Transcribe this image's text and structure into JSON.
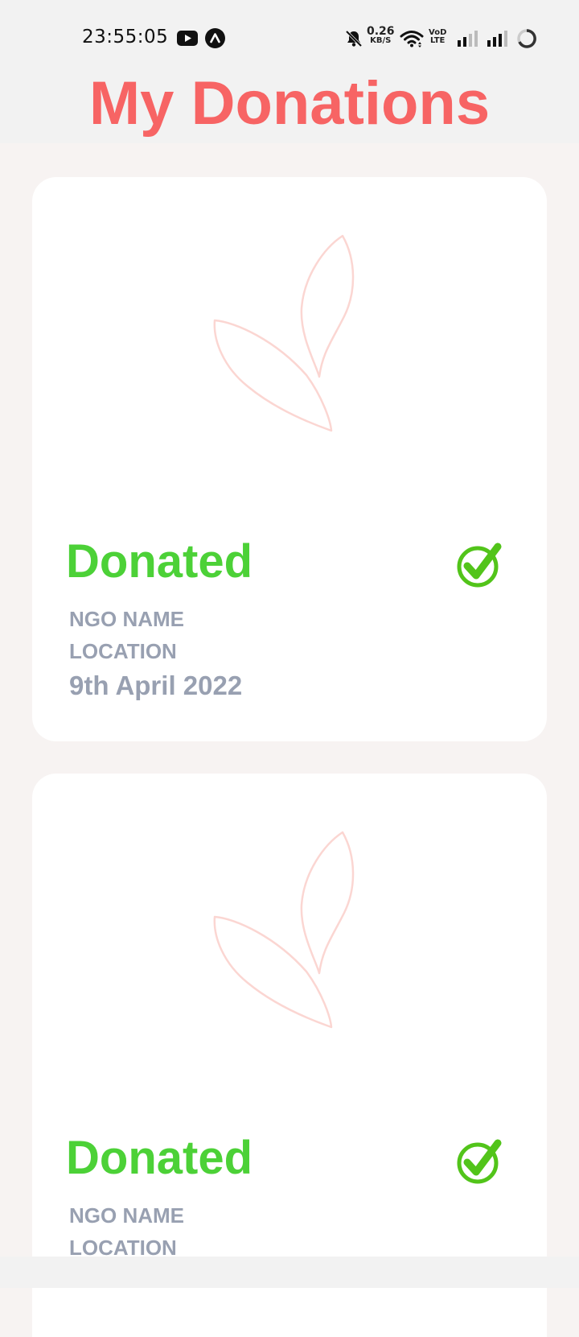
{
  "status_bar": {
    "time": "23:55:05",
    "speed_value": "0.26",
    "speed_unit": "KB/S",
    "volte_top": "VoD",
    "volte_bottom": "LTE"
  },
  "header": {
    "title": "My Donations"
  },
  "donations": [
    {
      "status": "Donated",
      "ngo_name": "NGO NAME",
      "location": "LOCATION",
      "date": "9th April 2022"
    },
    {
      "status": "Donated",
      "ngo_name": "NGO NAME",
      "location": "LOCATION"
    }
  ],
  "colors": {
    "title": "#f76464",
    "status": "#4cd137",
    "meta": "#98a0b1",
    "leaf_outline": "#fbd6d2"
  },
  "icons": {
    "youtube": "youtube-icon",
    "app": "app-notification-icon",
    "mute": "bell-off-icon",
    "wifi": "wifi-icon",
    "signal": "signal-icon",
    "battery": "battery-ring-icon",
    "check": "check-circle-icon",
    "leaf": "leaf-placeholder-icon"
  }
}
